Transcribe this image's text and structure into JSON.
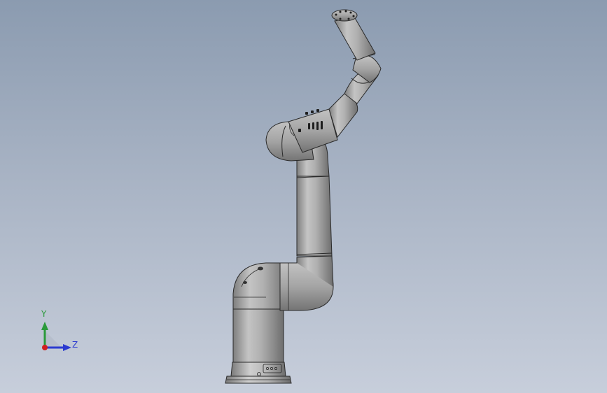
{
  "viewport": {
    "background_top": "#8b9bb0",
    "background_bottom": "#c7cedb",
    "model_color": "#a6a6a6"
  },
  "triad": {
    "y_label": "Y",
    "z_label": "Z",
    "y_color": "#2a9a3a",
    "z_color": "#2c3bd0",
    "x_color": "#d02020"
  }
}
